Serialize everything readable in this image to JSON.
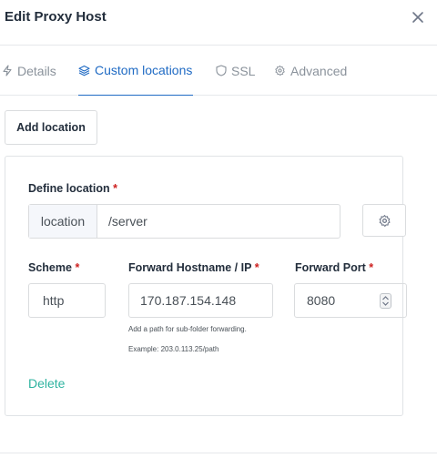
{
  "modal": {
    "title": "Edit Proxy Host"
  },
  "tabs": [
    {
      "label": "Details",
      "icon": "lightning-icon",
      "active": false
    },
    {
      "label": "Custom locations",
      "icon": "layers-icon",
      "active": true
    },
    {
      "label": "SSL",
      "icon": "shield-icon",
      "active": false
    },
    {
      "label": "Advanced",
      "icon": "gear-icon",
      "active": false
    }
  ],
  "add_location_label": "Add location",
  "location": {
    "define_label": "Define location",
    "required_mark": "*",
    "addon_label": "location",
    "path_value": "/server",
    "scheme_label": "Scheme",
    "scheme_value": "http",
    "host_label": "Forward Hostname / IP",
    "host_value": "170.187.154.148",
    "port_label": "Forward Port",
    "port_value": "8080",
    "help_line1": "Add a path for sub-folder forwarding.",
    "help_line2": "Example: 203.0.113.25/path",
    "delete_label": "Delete"
  },
  "colors": {
    "accent": "#206bc4",
    "delete": "#2fb3a0",
    "required": "#cd201f",
    "muted": "#8a929b"
  }
}
